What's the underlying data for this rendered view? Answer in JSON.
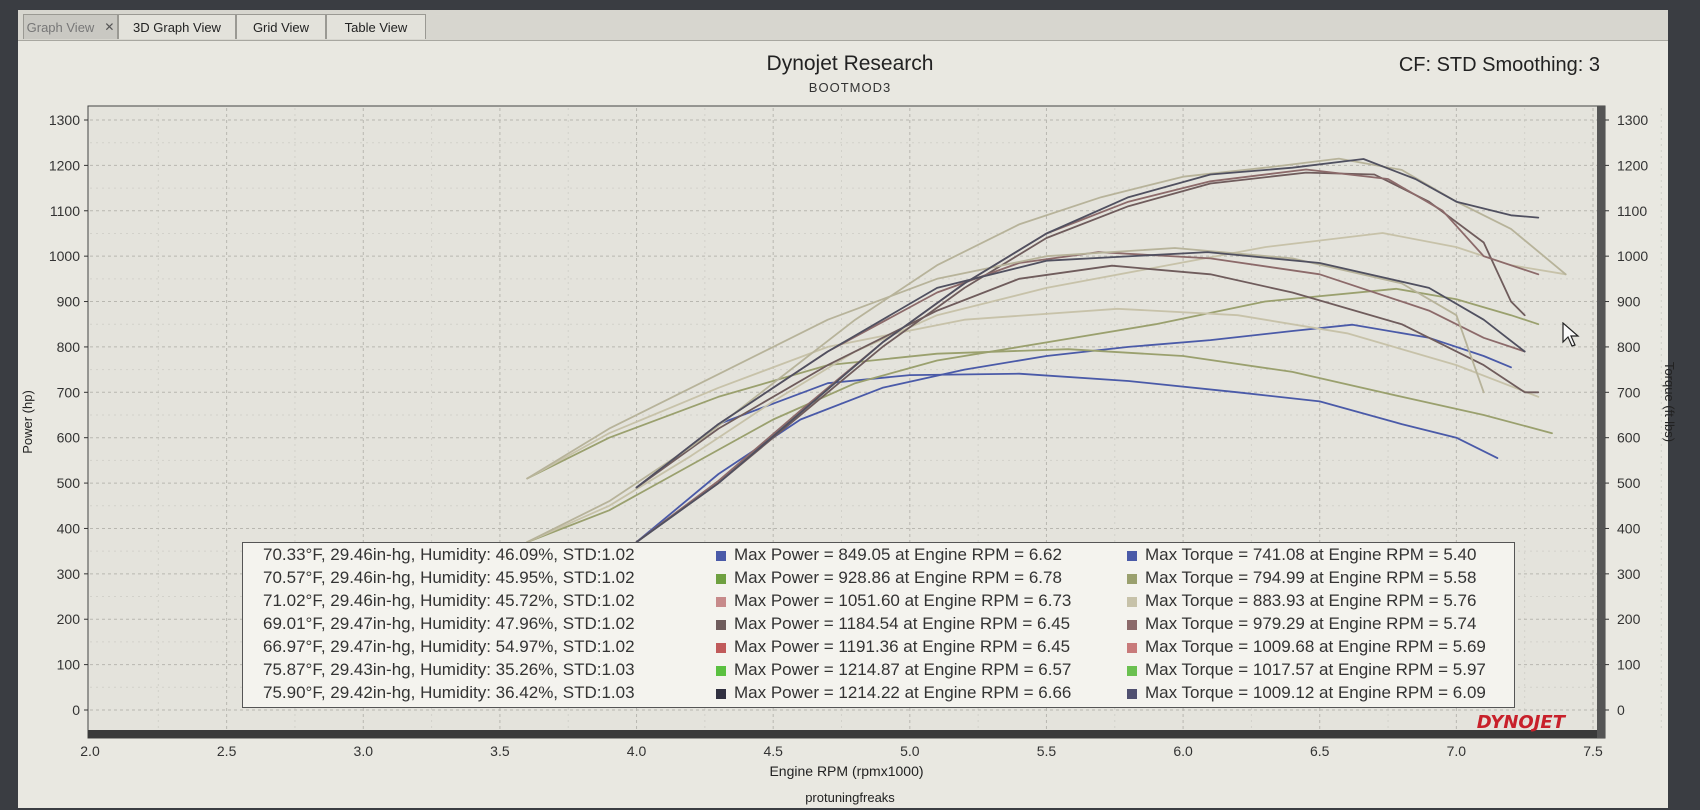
{
  "tabs": [
    {
      "label": "Graph View",
      "active": true
    },
    {
      "label": "3D Graph View",
      "active": false
    },
    {
      "label": "Grid View",
      "active": false
    },
    {
      "label": "Table View",
      "active": false
    }
  ],
  "tab_close_glyph": "✕",
  "header": {
    "title": "Dynojet Research",
    "subtitle": "BOOTMOD3",
    "correction": "CF: STD Smoothing: 3"
  },
  "footer": {
    "credit": "protuningfreaks"
  },
  "logo_text": "DYNOJET",
  "chart_data": {
    "type": "line",
    "xlabel": "Engine RPM (rpmx1000)",
    "ylabel": "Power (hp)",
    "y2label": "Torque (ft-lbs)",
    "xlim": [
      2.0,
      7.85
    ],
    "ylim": [
      -50,
      1330
    ],
    "x_ticks": [
      "2.0",
      "2.5",
      "3.0",
      "3.5",
      "4.0",
      "4.5",
      "5.0",
      "5.5",
      "6.0",
      "6.5",
      "7.0",
      "7.5"
    ],
    "y_ticks": [
      "0",
      "100",
      "200",
      "300",
      "400",
      "500",
      "600",
      "700",
      "800",
      "900",
      "1000",
      "1100",
      "1200",
      "1300"
    ],
    "grid": true,
    "legend_placement": "bottom-center",
    "series": [
      {
        "run": 1,
        "color": "#4a5aa8",
        "power": [
          [
            4.0,
            370
          ],
          [
            4.3,
            520
          ],
          [
            4.6,
            640
          ],
          [
            4.9,
            710
          ],
          [
            5.2,
            750
          ],
          [
            5.5,
            780
          ],
          [
            5.8,
            800
          ],
          [
            6.1,
            815
          ],
          [
            6.4,
            835
          ],
          [
            6.62,
            849
          ],
          [
            6.9,
            820
          ],
          [
            7.1,
            780
          ],
          [
            7.2,
            755
          ]
        ],
        "torque": [
          [
            4.0,
            490
          ],
          [
            4.3,
            630
          ],
          [
            4.7,
            720
          ],
          [
            5.0,
            738
          ],
          [
            5.4,
            741
          ],
          [
            5.8,
            725
          ],
          [
            6.2,
            700
          ],
          [
            6.5,
            680
          ],
          [
            6.8,
            630
          ],
          [
            7.0,
            600
          ],
          [
            7.15,
            555
          ]
        ]
      },
      {
        "run": 2,
        "color": "#9aa06e",
        "power": [
          [
            3.6,
            370
          ],
          [
            3.9,
            440
          ],
          [
            4.2,
            540
          ],
          [
            4.5,
            640
          ],
          [
            4.8,
            720
          ],
          [
            5.1,
            770
          ],
          [
            5.5,
            810
          ],
          [
            5.9,
            850
          ],
          [
            6.3,
            900
          ],
          [
            6.78,
            928
          ],
          [
            7.0,
            905
          ],
          [
            7.2,
            870
          ],
          [
            7.3,
            850
          ]
        ],
        "torque": [
          [
            3.6,
            510
          ],
          [
            3.9,
            600
          ],
          [
            4.3,
            690
          ],
          [
            4.7,
            760
          ],
          [
            5.1,
            785
          ],
          [
            5.58,
            795
          ],
          [
            6.0,
            780
          ],
          [
            6.4,
            745
          ],
          [
            6.8,
            690
          ],
          [
            7.1,
            650
          ],
          [
            7.35,
            610
          ]
        ]
      },
      {
        "run": 3,
        "color": "#c7c2a9",
        "power": [
          [
            3.6,
            370
          ],
          [
            3.9,
            450
          ],
          [
            4.2,
            560
          ],
          [
            4.5,
            680
          ],
          [
            4.8,
            790
          ],
          [
            5.1,
            870
          ],
          [
            5.5,
            930
          ],
          [
            5.9,
            975
          ],
          [
            6.3,
            1020
          ],
          [
            6.73,
            1051
          ],
          [
            7.0,
            1020
          ],
          [
            7.2,
            980
          ],
          [
            7.4,
            960
          ]
        ],
        "torque": [
          [
            3.6,
            510
          ],
          [
            3.9,
            610
          ],
          [
            4.3,
            710
          ],
          [
            4.7,
            800
          ],
          [
            5.2,
            860
          ],
          [
            5.76,
            884
          ],
          [
            6.2,
            870
          ],
          [
            6.6,
            830
          ],
          [
            7.0,
            760
          ],
          [
            7.3,
            690
          ]
        ]
      },
      {
        "run": 4,
        "color": "#6f5c5c",
        "power": [
          [
            4.0,
            370
          ],
          [
            4.3,
            500
          ],
          [
            4.6,
            650
          ],
          [
            4.9,
            800
          ],
          [
            5.2,
            930
          ],
          [
            5.5,
            1040
          ],
          [
            5.8,
            1110
          ],
          [
            6.1,
            1160
          ],
          [
            6.45,
            1184
          ],
          [
            6.7,
            1180
          ],
          [
            6.9,
            1120
          ],
          [
            7.1,
            1030
          ],
          [
            7.2,
            900
          ],
          [
            7.25,
            870
          ]
        ],
        "torque": [
          [
            4.0,
            490
          ],
          [
            4.3,
            620
          ],
          [
            4.7,
            760
          ],
          [
            5.1,
            880
          ],
          [
            5.4,
            950
          ],
          [
            5.74,
            979
          ],
          [
            6.1,
            960
          ],
          [
            6.4,
            920
          ],
          [
            6.8,
            850
          ],
          [
            7.1,
            760
          ],
          [
            7.25,
            700
          ],
          [
            7.3,
            700
          ]
        ]
      },
      {
        "run": 5,
        "color": "#8c6a6a",
        "power": [
          [
            4.0,
            370
          ],
          [
            4.3,
            505
          ],
          [
            4.6,
            660
          ],
          [
            4.9,
            810
          ],
          [
            5.2,
            940
          ],
          [
            5.5,
            1050
          ],
          [
            5.8,
            1120
          ],
          [
            6.1,
            1165
          ],
          [
            6.45,
            1191
          ],
          [
            6.75,
            1170
          ],
          [
            6.95,
            1100
          ],
          [
            7.1,
            1000
          ],
          [
            7.3,
            960
          ]
        ],
        "torque": [
          [
            4.0,
            490
          ],
          [
            4.3,
            630
          ],
          [
            4.7,
            790
          ],
          [
            5.1,
            920
          ],
          [
            5.4,
            985
          ],
          [
            5.69,
            1009
          ],
          [
            6.1,
            995
          ],
          [
            6.5,
            960
          ],
          [
            6.9,
            880
          ],
          [
            7.1,
            820
          ],
          [
            7.25,
            790
          ]
        ]
      },
      {
        "run": 6,
        "color": "#b7b39a",
        "power": [
          [
            3.6,
            370
          ],
          [
            3.9,
            460
          ],
          [
            4.2,
            580
          ],
          [
            4.5,
            720
          ],
          [
            4.8,
            860
          ],
          [
            5.1,
            980
          ],
          [
            5.4,
            1070
          ],
          [
            5.7,
            1130
          ],
          [
            6.0,
            1175
          ],
          [
            6.3,
            1195
          ],
          [
            6.57,
            1215
          ],
          [
            6.8,
            1190
          ],
          [
            7.0,
            1120
          ],
          [
            7.2,
            1060
          ],
          [
            7.4,
            960
          ]
        ],
        "torque": [
          [
            3.6,
            510
          ],
          [
            3.9,
            620
          ],
          [
            4.3,
            740
          ],
          [
            4.7,
            860
          ],
          [
            5.1,
            950
          ],
          [
            5.5,
            1000
          ],
          [
            5.97,
            1018
          ],
          [
            6.4,
            995
          ],
          [
            6.8,
            940
          ],
          [
            7.0,
            870
          ],
          [
            7.1,
            700
          ]
        ]
      },
      {
        "run": 7,
        "color": "#505060",
        "power": [
          [
            4.0,
            370
          ],
          [
            4.3,
            500
          ],
          [
            4.6,
            655
          ],
          [
            4.9,
            810
          ],
          [
            5.2,
            940
          ],
          [
            5.5,
            1050
          ],
          [
            5.8,
            1130
          ],
          [
            6.1,
            1180
          ],
          [
            6.4,
            1195
          ],
          [
            6.66,
            1214
          ],
          [
            6.85,
            1170
          ],
          [
            7.0,
            1120
          ],
          [
            7.2,
            1090
          ],
          [
            7.3,
            1085
          ]
        ],
        "torque": [
          [
            4.0,
            490
          ],
          [
            4.3,
            630
          ],
          [
            4.7,
            790
          ],
          [
            5.1,
            930
          ],
          [
            5.5,
            990
          ],
          [
            6.09,
            1009
          ],
          [
            6.5,
            985
          ],
          [
            6.9,
            930
          ],
          [
            7.1,
            860
          ],
          [
            7.25,
            790
          ]
        ]
      }
    ],
    "legend": [
      {
        "conditions": "70.33°F, 29.46in-hg, Humidity: 46.09%, STD:1.02",
        "power": "Max Power = 849.05 at Engine RPM = 6.62",
        "torque": "Max Torque = 741.08 at Engine RPM = 5.40",
        "power_color": "#4a5aa8",
        "torque_color": "#4a5aa8"
      },
      {
        "conditions": "70.57°F, 29.46in-hg, Humidity: 45.95%, STD:1.02",
        "power": "Max Power = 928.86 at Engine RPM = 6.78",
        "torque": "Max Torque = 794.99 at Engine RPM = 5.58",
        "power_color": "#6ea040",
        "torque_color": "#9aa06e"
      },
      {
        "conditions": "71.02°F, 29.46in-hg, Humidity: 45.72%, STD:1.02",
        "power": "Max Power = 1051.60 at Engine RPM = 6.73",
        "torque": "Max Torque = 883.93 at Engine RPM = 5.76",
        "power_color": "#c78a8a",
        "torque_color": "#c7c2a9"
      },
      {
        "conditions": "69.01°F, 29.47in-hg, Humidity: 47.96%, STD:1.02",
        "power": "Max Power = 1184.54 at Engine RPM = 6.45",
        "torque": "Max Torque = 979.29 at Engine RPM = 5.74",
        "power_color": "#6f5c5c",
        "torque_color": "#8c6a6a"
      },
      {
        "conditions": "66.97°F, 29.47in-hg, Humidity: 54.97%, STD:1.02",
        "power": "Max Power = 1191.36 at Engine RPM = 6.45",
        "torque": "Max Torque = 1009.68 at Engine RPM = 5.69",
        "power_color": "#c05a5a",
        "torque_color": "#c87a7a"
      },
      {
        "conditions": "75.87°F, 29.43in-hg, Humidity: 35.26%, STD:1.03",
        "power": "Max Power = 1214.87 at Engine RPM = 6.57",
        "torque": "Max Torque = 1017.57 at Engine RPM = 5.97",
        "power_color": "#5ac040",
        "torque_color": "#6ac050"
      },
      {
        "conditions": "75.90°F, 29.42in-hg, Humidity: 36.42%, STD:1.03",
        "power": "Max Power = 1214.22 at Engine RPM = 6.66",
        "torque": "Max Torque = 1009.12 at Engine RPM = 6.09",
        "power_color": "#303040",
        "torque_color": "#505070"
      }
    ]
  }
}
